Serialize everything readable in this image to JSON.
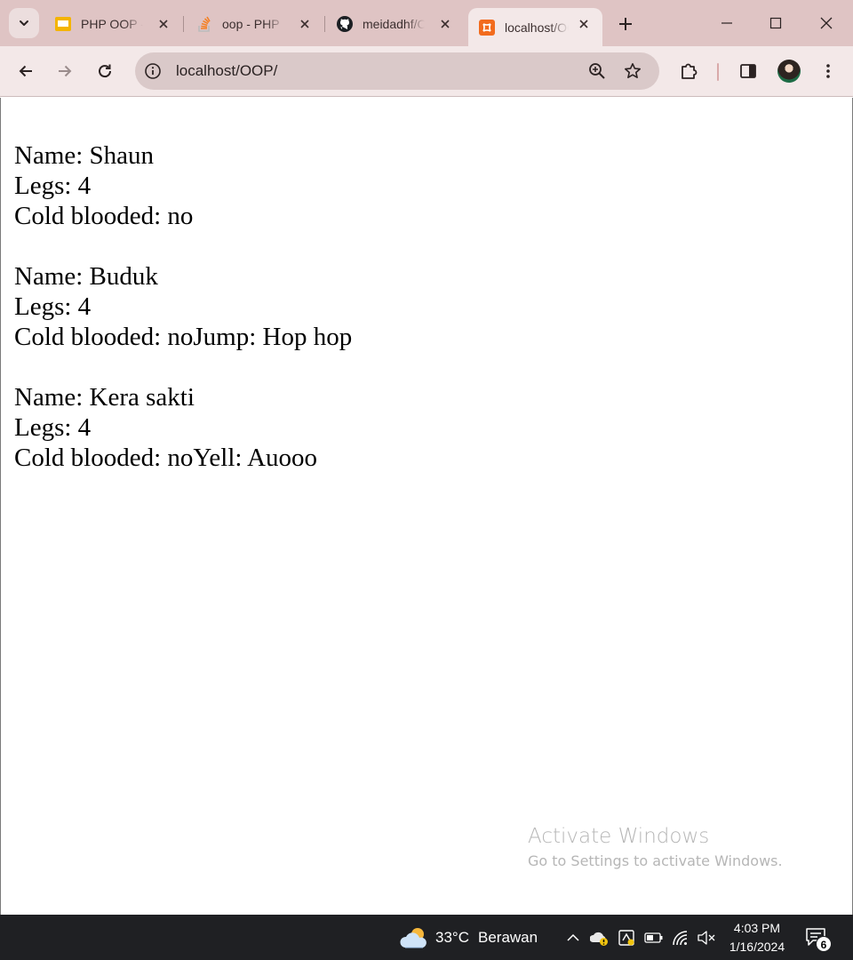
{
  "browser": {
    "tabs": [
      {
        "title": "PHP OOP - Object Oriented Programming",
        "icon": "slides-icon"
      },
      {
        "title": "oop - PHP",
        "icon": "stackoverflow-icon"
      },
      {
        "title": "meidadhf/OOP",
        "icon": "github-icon"
      },
      {
        "title": "localhost/OOP/",
        "icon": "xampp-icon",
        "active": true
      }
    ],
    "address": {
      "url": "localhost/OOP/"
    }
  },
  "page": {
    "animals": [
      {
        "name_line": "Name: Shaun",
        "legs_line": "Legs: 4",
        "cold_line": "Cold blooded: no"
      },
      {
        "name_line": "Name: Buduk",
        "legs_line": "Legs: 4",
        "cold_line": "Cold blooded: noJump: Hop hop"
      },
      {
        "name_line": "Name: Kera sakti",
        "legs_line": "Legs: 4",
        "cold_line": "Cold blooded: noYell: Auooo"
      }
    ]
  },
  "watermark": {
    "title": "Activate Windows",
    "subtitle": "Go to Settings to activate Windows."
  },
  "taskbar": {
    "temperature": "33°C",
    "condition": "Berawan",
    "time": "4:03 PM",
    "date": "1/16/2024",
    "notification_count": "6"
  },
  "colors": {
    "tabstrip": "#dfc4c4",
    "toolbar": "#f3e8e8",
    "omnibox": "#dac9c9",
    "taskbar": "#1f2023"
  }
}
